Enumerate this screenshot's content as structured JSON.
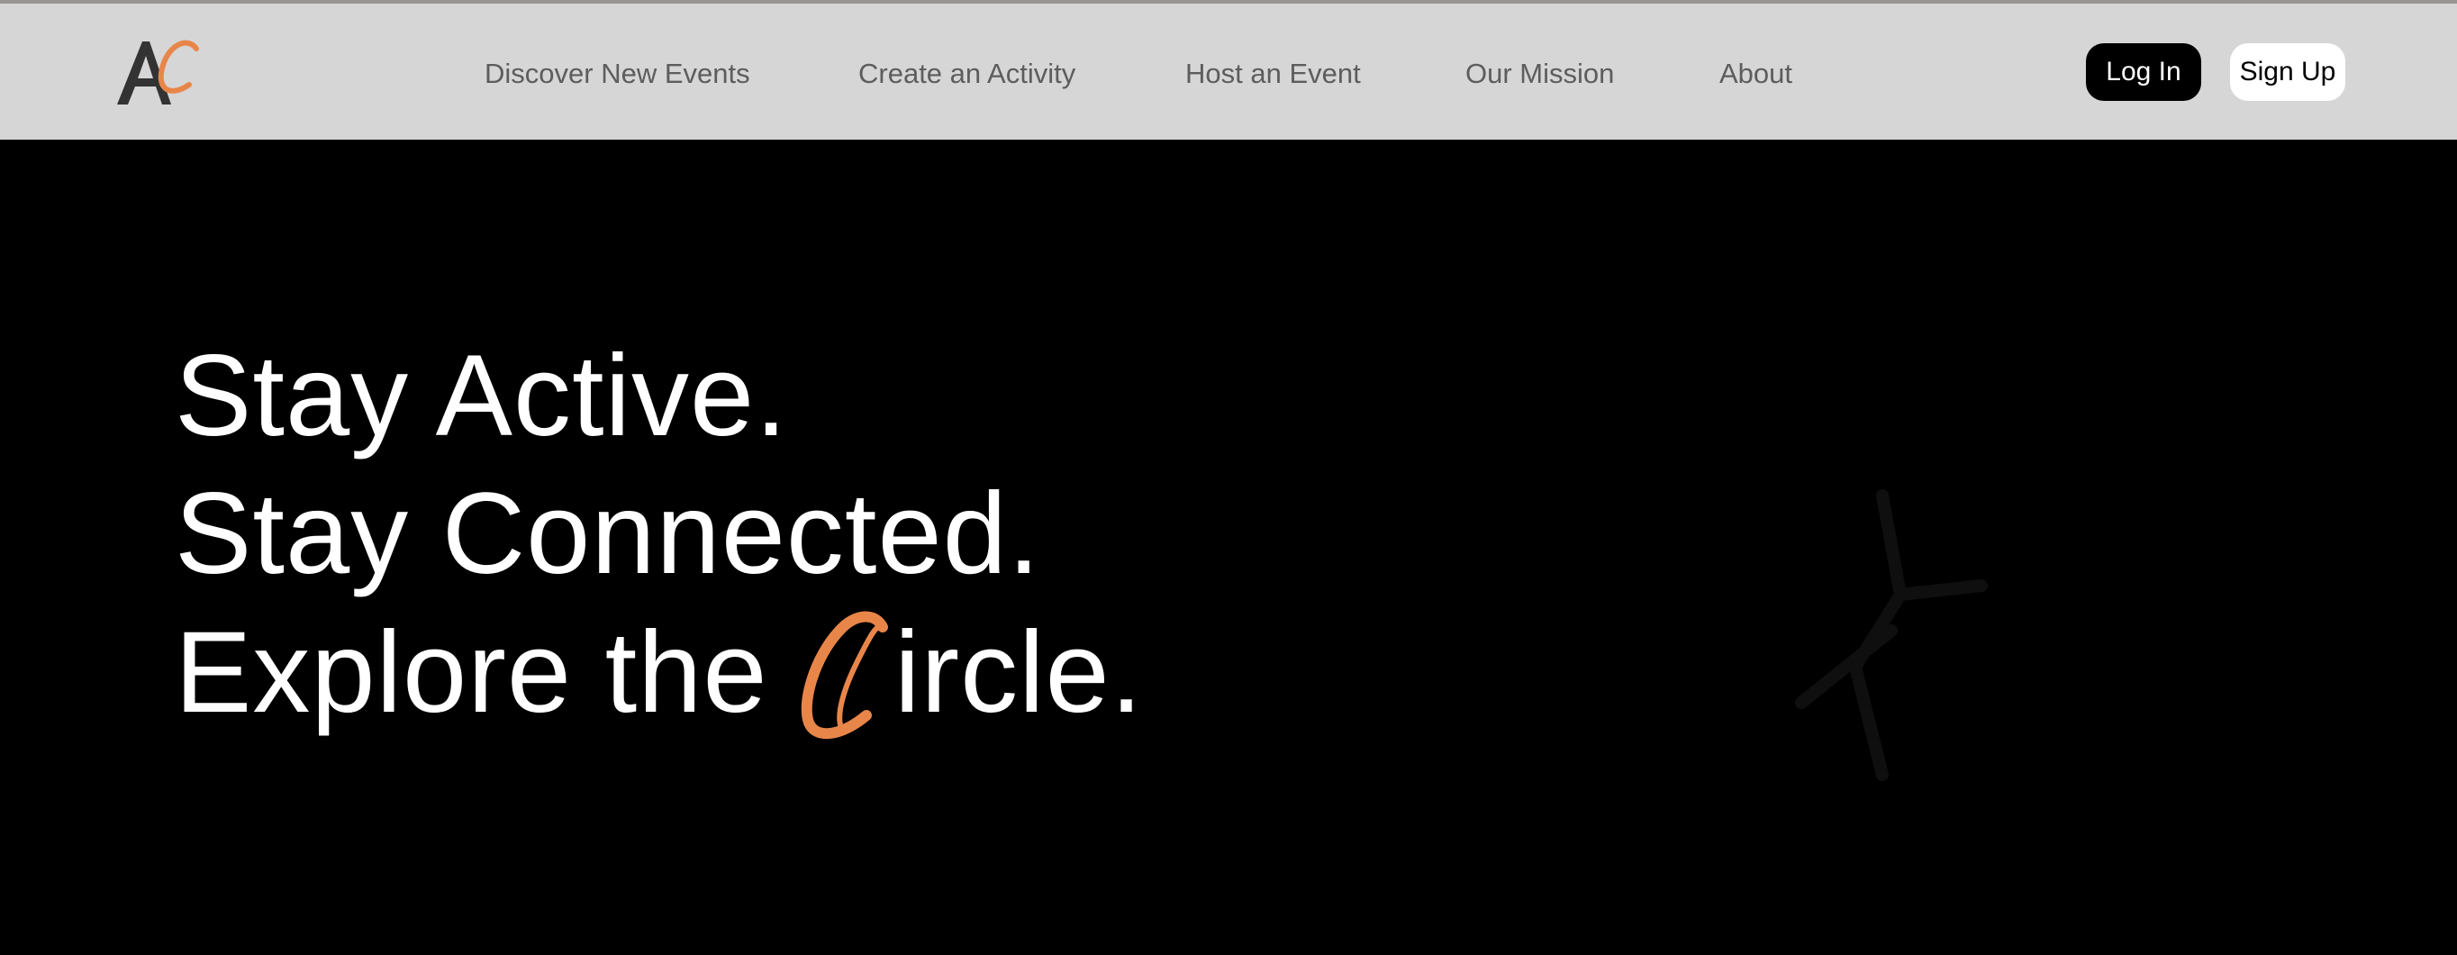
{
  "header": {
    "logo_letter": "A",
    "logo_accent": "c",
    "nav": [
      "Discover New Events",
      "Create an Activity",
      "Host an Event",
      "Our Mission",
      "About"
    ],
    "login_label": "Log In",
    "signup_label": "Sign Up"
  },
  "hero": {
    "line1": "Stay Active.",
    "line2": "Stay Connected.",
    "line3_prefix": "Explore the",
    "line3_suffix": "ircle."
  },
  "colors": {
    "accent": "#e8864a",
    "header_bg": "#d6d6d6",
    "hero_bg": "#000000"
  },
  "icons": {
    "logo": "ac-logo-icon",
    "script_c": "script-c-icon"
  }
}
